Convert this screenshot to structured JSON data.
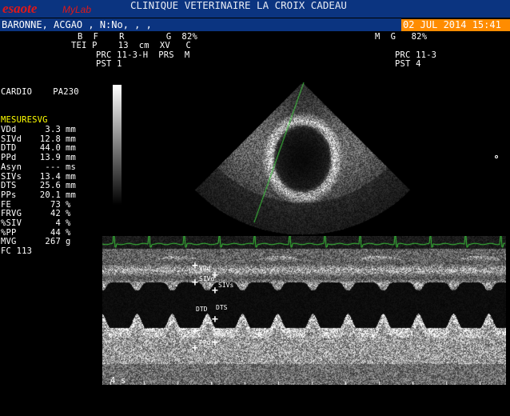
{
  "header": {
    "brand": "esaote",
    "brand_sub": "MyLab",
    "clinic": "CLINIQUE VETERINAIRE LA CROIX CADEAU",
    "date": "02 JUL 2014 15:41",
    "patient": "BARONNE, ACGAO , N:No, , ,"
  },
  "params_left": {
    "row1": "B  F    R        G  82%",
    "row2": "TEI P    13  cm  XV   C",
    "row3": "PRC 11-3-H  PRS  M",
    "row4": "PST 1"
  },
  "params_right": {
    "row1": "M  G   82%",
    "row3": "PRC 11-3",
    "row4": "PST 4"
  },
  "mode": "CARDIO    PA230",
  "measurements": {
    "title": "MESURESVG",
    "rows": [
      {
        "label": "VDd",
        "value": "3.3",
        "unit": "mm"
      },
      {
        "label": "SIVd",
        "value": "12.8",
        "unit": "mm"
      },
      {
        "label": "DTD",
        "value": "44.0",
        "unit": "mm"
      },
      {
        "label": "PPd",
        "value": "13.9",
        "unit": "mm"
      },
      {
        "label": "Asyn",
        "value": "---",
        "unit": "ms"
      },
      {
        "label": "SIVs",
        "value": "13.4",
        "unit": "mm"
      },
      {
        "label": "DTS",
        "value": "25.6",
        "unit": "mm"
      },
      {
        "label": "PPs",
        "value": "20.1",
        "unit": "mm"
      },
      {
        "label": "FE",
        "value": "73",
        "unit": "%"
      },
      {
        "label": "FRVG",
        "value": "42",
        "unit": "%"
      },
      {
        "label": "%SIV",
        "value": "4",
        "unit": "%"
      },
      {
        "label": "%PP",
        "value": "44",
        "unit": "%"
      },
      {
        "label": "MVG",
        "value": "267",
        "unit": "g"
      }
    ],
    "fc": "FC 113"
  },
  "mmode_labels": {
    "vd": "VDd",
    "sivd": "SIVd",
    "sivs": "SIVs",
    "dtd": "DTD",
    "dts": "DTS",
    "pps": "PPs",
    "ppd": "PPd",
    "time": "4 s"
  },
  "colors": {
    "header_bg": "#0b3480",
    "date_bg": "#ff8c00",
    "measure_title": "#ffff00",
    "ecg": "#3ecf3e",
    "brand": "#e01818"
  }
}
